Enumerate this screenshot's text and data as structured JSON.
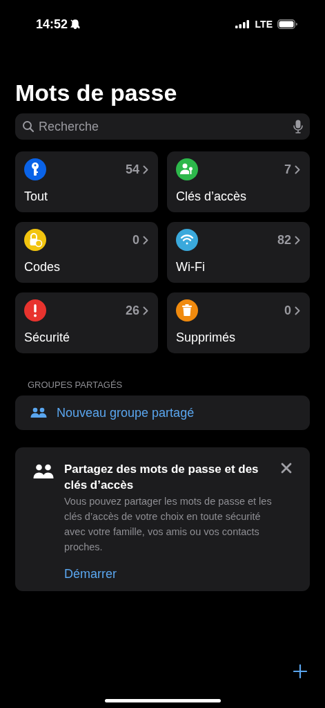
{
  "status_bar": {
    "time": "14:52",
    "network": "LTE"
  },
  "title": "Mots de passe",
  "search": {
    "placeholder": "Recherche"
  },
  "categories": [
    {
      "label": "Tout",
      "count": "54",
      "kind": "key",
      "color": "#0a63e8"
    },
    {
      "label": "Clés d’accès",
      "count": "7",
      "kind": "passkey",
      "color": "#2db84b"
    },
    {
      "label": "Codes",
      "count": "0",
      "kind": "lock",
      "color": "#f2c40f"
    },
    {
      "label": "Wi-Fi",
      "count": "82",
      "kind": "wifi",
      "color": "#3aa9dc"
    },
    {
      "label": "Sécurité",
      "count": "26",
      "kind": "alert",
      "color": "#e8332e"
    },
    {
      "label": "Supprimés",
      "count": "0",
      "kind": "trash",
      "color": "#f08a0e"
    }
  ],
  "shared_groups": {
    "header": "GROUPES PARTAGÉS",
    "new_group": "Nouveau groupe partagé"
  },
  "share_card": {
    "title": "Partagez des mots de passe et des clés d’accès",
    "body": "Vous pouvez partager les mots de passe et les clés d’accès de votre choix en toute sécurité avec votre famille, vos amis ou vos contacts proches.",
    "action": "Démarrer"
  }
}
